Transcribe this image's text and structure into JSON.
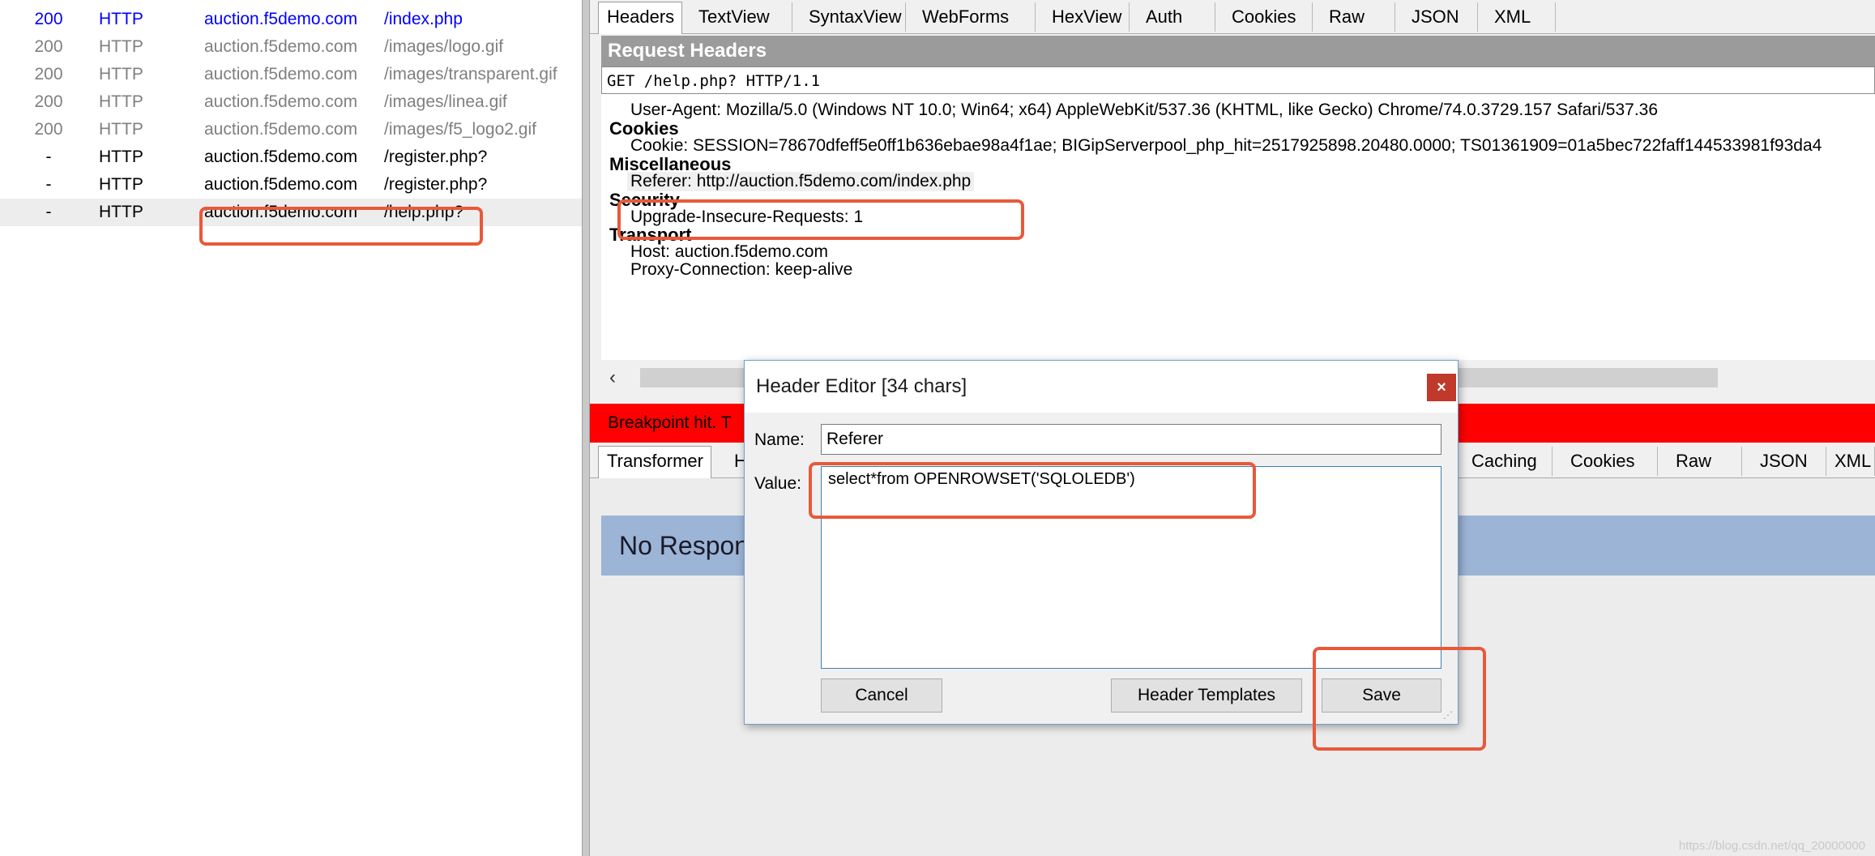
{
  "sessions": [
    {
      "result": "200",
      "protocol": "HTTP",
      "host": "auction.f5demo.com",
      "url": "/index.php",
      "color": "#0000ff"
    },
    {
      "result": "200",
      "protocol": "HTTP",
      "host": "auction.f5demo.com",
      "url": "/images/logo.gif",
      "color": "#808080"
    },
    {
      "result": "200",
      "protocol": "HTTP",
      "host": "auction.f5demo.com",
      "url": "/images/transparent.gif",
      "color": "#808080"
    },
    {
      "result": "200",
      "protocol": "HTTP",
      "host": "auction.f5demo.com",
      "url": "/images/linea.gif",
      "color": "#808080"
    },
    {
      "result": "200",
      "protocol": "HTTP",
      "host": "auction.f5demo.com",
      "url": "/images/f5_logo2.gif",
      "color": "#808080"
    },
    {
      "result": "-",
      "protocol": "HTTP",
      "host": "auction.f5demo.com",
      "url": "/register.php?",
      "color": "#000000"
    },
    {
      "result": "-",
      "protocol": "HTTP",
      "host": "auction.f5demo.com",
      "url": "/register.php?",
      "color": "#000000"
    },
    {
      "result": "-",
      "protocol": "HTTP",
      "host": "auction.f5demo.com",
      "url": "/help.php?",
      "color": "#000000",
      "selected": true
    }
  ],
  "request_tabs": [
    "Headers",
    "TextView",
    "SyntaxView",
    "WebForms",
    "HexView",
    "Auth",
    "Cookies",
    "Raw",
    "JSON",
    "XML"
  ],
  "request_headers": {
    "title": "Request Headers",
    "request_line": "GET /help.php? HTTP/1.1",
    "user_agent": "User-Agent: Mozilla/5.0 (Windows NT 10.0; Win64; x64) AppleWebKit/537.36 (KHTML, like Gecko) Chrome/74.0.3729.157 Safari/537.36",
    "groups": {
      "cookies": "Cookies",
      "miscellaneous": "Miscellaneous",
      "security": "Security",
      "transport": "Transport"
    },
    "cookie": "Cookie: SESSION=78670dfeff5e0ff1b636ebae98a4f1ae; BIGipServerpool_php_hit=2517925898.20480.0000; TS01361909=01a5bec722faff144533981f93da4",
    "referer": "Referer: http://auction.f5demo.com/index.php",
    "upgrade": "Upgrade-Insecure-Requests: 1",
    "host": "Host: auction.f5demo.com",
    "proxy_connection": "Proxy-Connection: keep-alive"
  },
  "scroll_left_glyph": "‹",
  "breakpoint_text": "Breakpoint hit. T",
  "response_tabs_left": [
    "Transformer",
    "H"
  ],
  "response_tabs_right": [
    "Caching",
    "Cookies",
    "Raw",
    "JSON",
    "XML"
  ],
  "no_response_text": "No Respon",
  "dialog": {
    "title": "Header Editor [34 chars]",
    "close_glyph": "×",
    "name_label": "Name:",
    "name_value": "Referer",
    "value_label": "Value:",
    "value_text": "select*from OPENROWSET('SQLOLEDB')",
    "cancel_label": "Cancel",
    "templates_label": "Header Templates",
    "save_label": "Save"
  },
  "watermark": "https://blog.csdn.net/qq_20000000",
  "colors": {
    "annotation": "#e8593a",
    "breakpoint": "#ff0000",
    "no_response_bg": "#9cb4d6",
    "selected_row": "#ededed"
  }
}
